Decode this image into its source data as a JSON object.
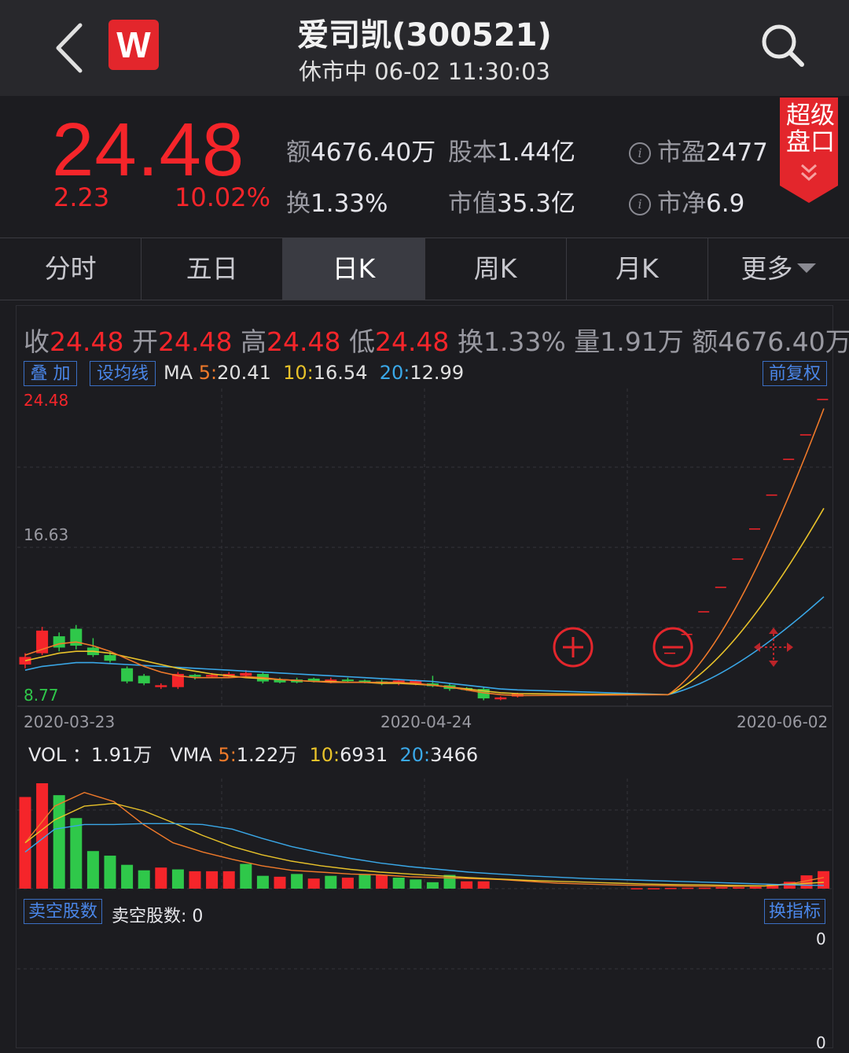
{
  "header": {
    "title": "爱司凯(300521)",
    "subtitle": "休市中 06-02 11:30:03",
    "logo_letter": "W"
  },
  "quote": {
    "price": "24.48",
    "change": "2.23",
    "change_pct": "10.02%",
    "amount_label": "额",
    "amount": "4676.40万",
    "shares_label": "股本",
    "shares": "1.44亿",
    "pe_label": "市盈",
    "pe": "2477",
    "turnover_label": "换",
    "turnover": "1.33%",
    "mktcap_label": "市值",
    "mktcap": "35.3亿",
    "pb_label": "市净",
    "pb": "6.9",
    "badge_line1": "超级",
    "badge_line2": "盘口"
  },
  "tabs": [
    {
      "label": "分时",
      "active": false
    },
    {
      "label": "五日",
      "active": false
    },
    {
      "label": "日K",
      "active": true
    },
    {
      "label": "周K",
      "active": false
    },
    {
      "label": "月K",
      "active": false
    },
    {
      "label": "更多",
      "active": false
    }
  ],
  "ohlc": {
    "close_label": "收",
    "close": "24.48",
    "open_label": "开",
    "open": "24.48",
    "high_label": "高",
    "high": "24.48",
    "low_label": "低",
    "low": "24.48",
    "turnover_label": "换",
    "turnover": "1.33%",
    "volume_label": "量",
    "volume": "1.91万",
    "amount_label": "额",
    "amount": "4676.40万"
  },
  "controls": {
    "overlay_button": "叠 加",
    "ma_setting_button": "设均线",
    "adjust_button": "前复权",
    "short_button": "卖空股数",
    "indicator_button": "换指标"
  },
  "ma_legend": {
    "prefix": "MA",
    "ma5_label": "5",
    "ma5": "20.41",
    "ma10_label": "10",
    "ma10": "16.54",
    "ma20_label": "20",
    "ma20": "12.99"
  },
  "vol_legend": {
    "vol_label": "VOL ：",
    "vol": "1.91万",
    "vma_label": "VMA",
    "vma5_label": "5",
    "vma5": "1.22万",
    "vma10_label": "10",
    "vma10": "6931",
    "vma20_label": "20",
    "vma20": "3466"
  },
  "short_text": "卖空股数: 0",
  "zero_top": "0",
  "zero_bottom": "0",
  "colors": {
    "up": "#f5252a",
    "down": "#2fc84a",
    "ma5": "#f07a2a",
    "ma10": "#e8c22a",
    "ma20": "#3aa8e8",
    "accent": "#4a86e8"
  },
  "chart_data": {
    "type": "candlestick",
    "ylim": [
      8.77,
      24.48
    ],
    "y_ticks": [
      "24.48",
      "16.63",
      "8.77"
    ],
    "x_ticks": [
      "2020-03-23",
      "2020-04-24",
      "2020-06-02"
    ],
    "candles": [
      {
        "o": 10.4,
        "c": 10.8,
        "h": 11.0,
        "l": 10.2,
        "up": true
      },
      {
        "o": 11.0,
        "c": 12.2,
        "h": 12.4,
        "l": 10.9,
        "up": true
      },
      {
        "o": 11.9,
        "c": 11.3,
        "h": 12.1,
        "l": 11.1,
        "up": false
      },
      {
        "o": 12.3,
        "c": 11.4,
        "h": 12.5,
        "l": 11.2,
        "up": false
      },
      {
        "o": 11.3,
        "c": 10.9,
        "h": 11.8,
        "l": 10.8,
        "up": false
      },
      {
        "o": 10.9,
        "c": 10.6,
        "h": 11.1,
        "l": 10.5,
        "up": false
      },
      {
        "o": 10.2,
        "c": 9.5,
        "h": 10.3,
        "l": 9.4,
        "up": false
      },
      {
        "o": 9.8,
        "c": 9.4,
        "h": 9.9,
        "l": 9.3,
        "up": false
      },
      {
        "o": 9.2,
        "c": 9.3,
        "h": 9.4,
        "l": 9.1,
        "up": true
      },
      {
        "o": 9.2,
        "c": 9.9,
        "h": 10.0,
        "l": 9.1,
        "up": true
      },
      {
        "o": 9.85,
        "c": 9.75,
        "h": 9.9,
        "l": 9.6,
        "up": false
      },
      {
        "o": 9.75,
        "c": 9.85,
        "h": 9.95,
        "l": 9.7,
        "up": true
      },
      {
        "o": 9.75,
        "c": 9.9,
        "h": 10.0,
        "l": 9.7,
        "up": true
      },
      {
        "o": 9.95,
        "c": 9.8,
        "h": 10.1,
        "l": 9.75,
        "up": true
      },
      {
        "o": 9.9,
        "c": 9.5,
        "h": 10.0,
        "l": 9.4,
        "up": false
      },
      {
        "o": 9.6,
        "c": 9.45,
        "h": 9.7,
        "l": 9.4,
        "up": false
      },
      {
        "o": 9.6,
        "c": 9.45,
        "h": 9.7,
        "l": 9.4,
        "up": false
      },
      {
        "o": 9.65,
        "c": 9.5,
        "h": 9.7,
        "l": 9.45,
        "up": false
      },
      {
        "o": 9.45,
        "c": 9.6,
        "h": 9.7,
        "l": 9.4,
        "up": true
      },
      {
        "o": 9.6,
        "c": 9.55,
        "h": 9.7,
        "l": 9.45,
        "up": false
      },
      {
        "o": 9.45,
        "c": 9.55,
        "h": 9.6,
        "l": 9.4,
        "up": false
      },
      {
        "o": 9.5,
        "c": 9.4,
        "h": 9.6,
        "l": 9.3,
        "up": false
      },
      {
        "o": 9.4,
        "c": 9.55,
        "h": 9.6,
        "l": 9.3,
        "up": true
      },
      {
        "o": 9.35,
        "c": 9.55,
        "h": 9.6,
        "l": 9.3,
        "up": true
      },
      {
        "o": 9.4,
        "c": 9.25,
        "h": 9.8,
        "l": 9.2,
        "up": false
      },
      {
        "o": 9.3,
        "c": 9.1,
        "h": 9.4,
        "l": 9.0,
        "up": false
      },
      {
        "o": 9.15,
        "c": 9.05,
        "h": 9.2,
        "l": 9.0,
        "up": false
      },
      {
        "o": 9.1,
        "c": 8.6,
        "h": 9.2,
        "l": 8.5,
        "up": false
      },
      {
        "o": 8.55,
        "c": 8.65,
        "h": 8.7,
        "l": 8.5,
        "up": true
      },
      {
        "o": 8.7,
        "c": 8.85,
        "h": 8.9,
        "l": 8.65,
        "up": true
      }
    ],
    "limit_ticks": [
      11.0,
      12.0,
      13.2,
      14.5,
      16.0,
      17.6,
      19.4,
      21.3,
      22.6,
      24.48
    ],
    "ma5": [
      10.9,
      11.2,
      11.5,
      11.6,
      11.4,
      11.1,
      10.7,
      10.3,
      10.0,
      9.8,
      9.7,
      9.7,
      9.7,
      9.75,
      9.7,
      9.6,
      9.55,
      9.5,
      9.45,
      9.45,
      9.45,
      9.45,
      9.45,
      9.4,
      9.3,
      9.2,
      9.05,
      8.9,
      8.8,
      8.75
    ],
    "ma10": [
      10.6,
      10.8,
      11.0,
      11.1,
      11.1,
      11.0,
      10.8,
      10.6,
      10.4,
      10.2,
      10.05,
      9.9,
      9.8,
      9.7,
      9.65,
      9.6,
      9.55,
      9.5,
      9.5,
      9.45,
      9.45,
      9.4,
      9.4,
      9.35,
      9.3,
      9.2,
      9.1,
      9.0,
      8.9,
      8.85
    ],
    "ma20": [
      10.1,
      10.3,
      10.4,
      10.5,
      10.5,
      10.45,
      10.4,
      10.35,
      10.3,
      10.25,
      10.2,
      10.15,
      10.1,
      10.05,
      10.0,
      9.95,
      9.9,
      9.85,
      9.8,
      9.75,
      9.7,
      9.65,
      9.6,
      9.55,
      9.5,
      9.4,
      9.3,
      9.2,
      9.1,
      9.05
    ],
    "volumes": [
      {
        "v": 10.0,
        "up": true
      },
      {
        "v": 11.5,
        "up": true
      },
      {
        "v": 10.2,
        "up": false
      },
      {
        "v": 7.7,
        "up": false
      },
      {
        "v": 4.1,
        "up": false
      },
      {
        "v": 3.6,
        "up": false
      },
      {
        "v": 2.6,
        "up": false
      },
      {
        "v": 2.0,
        "up": false
      },
      {
        "v": 2.3,
        "up": true
      },
      {
        "v": 2.1,
        "up": false
      },
      {
        "v": 1.9,
        "up": true
      },
      {
        "v": 1.9,
        "up": true
      },
      {
        "v": 1.9,
        "up": true
      },
      {
        "v": 2.7,
        "up": false
      },
      {
        "v": 1.4,
        "up": false
      },
      {
        "v": 1.3,
        "up": true
      },
      {
        "v": 1.6,
        "up": false
      },
      {
        "v": 1.1,
        "up": true
      },
      {
        "v": 1.4,
        "up": false
      },
      {
        "v": 1.2,
        "up": true
      },
      {
        "v": 1.5,
        "up": false
      },
      {
        "v": 1.5,
        "up": true
      },
      {
        "v": 1.2,
        "up": false
      },
      {
        "v": 1.0,
        "up": false
      },
      {
        "v": 0.7,
        "up": false
      },
      {
        "v": 1.5,
        "up": false
      },
      {
        "v": 0.8,
        "up": true
      },
      {
        "v": 0.8,
        "up": true
      }
    ],
    "volumes_recent": [
      0.05,
      0.05,
      0.08,
      0.1,
      0.1,
      0.15,
      0.15,
      0.2,
      0.45,
      0.75,
      1.45,
      1.91
    ],
    "vma_ylim": [
      0,
      11.5
    ]
  }
}
